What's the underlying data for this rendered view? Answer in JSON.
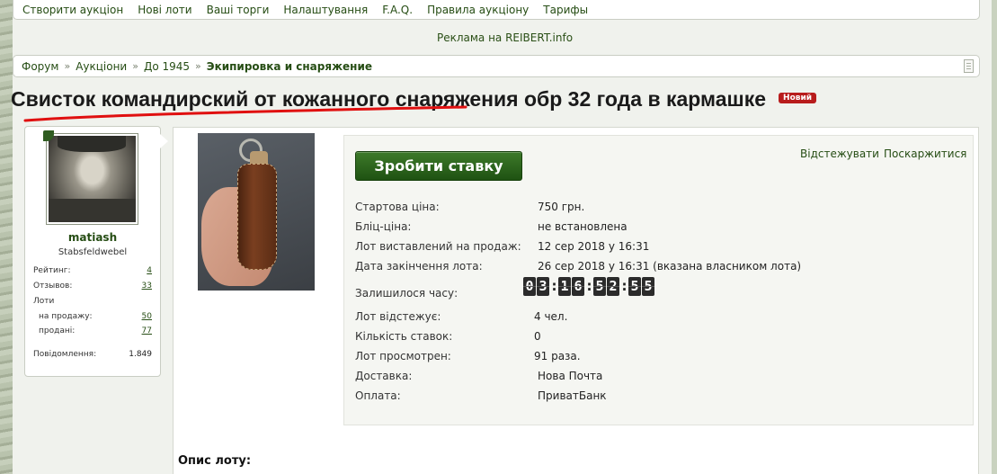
{
  "topnav": {
    "items": [
      "Створити аукціон",
      "Нові лоти",
      "Ваші торги",
      "Налаштування",
      "F.A.Q.",
      "Правила аукціону",
      "Тарифы"
    ]
  },
  "ad": {
    "text": "Реклама на REIBERT.info"
  },
  "breadcrumb": {
    "items": [
      "Форум",
      "Аукціони",
      "До 1945"
    ],
    "separator": "»",
    "current": "Экипировка и снаряжение"
  },
  "lot": {
    "title": "Свисток командирский от кожанного снаряжения обр 32 года в кармашке",
    "badge": "Новий"
  },
  "user": {
    "name": "matiash",
    "rank": "Stabsfeldwebel",
    "stats": {
      "rating_label": "Рейтинг:",
      "rating": "4",
      "reviews_label": "Отзывов:",
      "reviews": "33",
      "lots_label": "Лоти",
      "for_sale_label": "на продажу:",
      "for_sale": "50",
      "sold_label": "продані:",
      "sold": "77",
      "messages_label": "Повідомлення:",
      "messages": "1.849"
    }
  },
  "actions": {
    "bid_button": "Зробити ставку",
    "watch": "Відстежувати",
    "report": "Поскаржитися"
  },
  "details": [
    {
      "label": "Стартова ціна:",
      "value": "750 грн."
    },
    {
      "label": "Бліц-ціна:",
      "value": "не встановлена"
    },
    {
      "label": "Лот виставлений на продаж:",
      "value": "12 сер 2018 у 16:31"
    },
    {
      "label": "Дата закінчення лота:",
      "value": "26 сер 2018 у 16:31 (вказана власником лота)"
    },
    {
      "label": "Залишилося часу:",
      "value": ""
    },
    {
      "label": "Лот відстежує:",
      "value": "4 чел."
    },
    {
      "label": "Кількість ставок:",
      "value": "0"
    },
    {
      "label": "Лот просмотрен:",
      "value": "91 раза."
    },
    {
      "label": "Доставка:",
      "value": "Нова Почта"
    },
    {
      "label": "Оплата:",
      "value": "ПриватБанк"
    }
  ],
  "timer": {
    "d1": "0",
    "d2": "3",
    "h1": "1",
    "h2": "6",
    "m1": "5",
    "m2": "2",
    "s1": "5",
    "s2": "5",
    "colon": ":"
  },
  "description": {
    "title": "Опис лоту:"
  },
  "colors": {
    "accent": "#264d14",
    "button": "#2d6a1e",
    "badge": "#b81c1c",
    "underline_mark": "#e01010"
  }
}
